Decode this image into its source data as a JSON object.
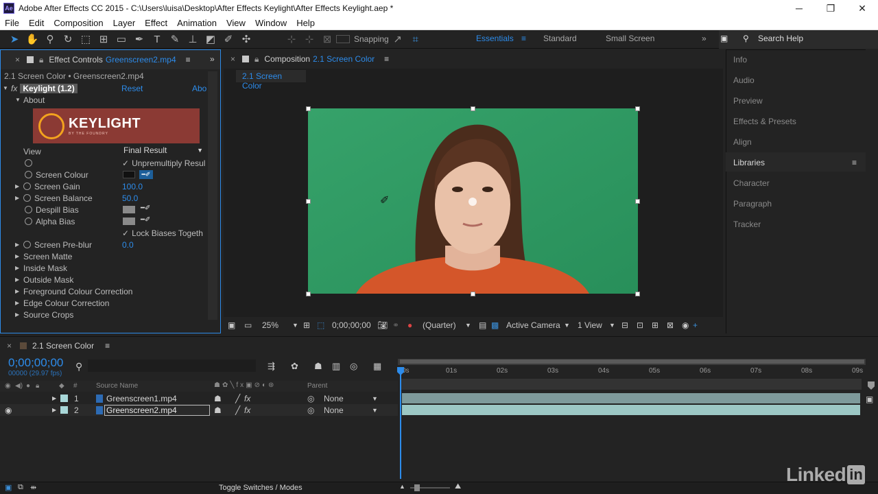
{
  "window": {
    "title": "Adobe After Effects CC 2015 - C:\\Users\\luisa\\Desktop\\After Effects Keylight\\After Effects Keylight.aep *",
    "logo_text": "Ae",
    "minimize": "─",
    "restore": "❐",
    "close": "✕"
  },
  "menu": [
    "File",
    "Edit",
    "Composition",
    "Layer",
    "Effect",
    "Animation",
    "View",
    "Window",
    "Help"
  ],
  "toolbar": {
    "snapping": "Snapping",
    "workspaces": [
      "Essentials",
      "Standard",
      "Small Screen"
    ],
    "search": "Search Help"
  },
  "effect_controls": {
    "tab_label": "Effect Controls",
    "tab_file": "Greenscreen2.mp4",
    "subtitle": "2.1 Screen Color • Greenscreen2.mp4",
    "effect_name": "Keylight (1.2)",
    "reset": "Reset",
    "about_link": "Abo",
    "about": "About",
    "logo_text": "KEYLIGHT",
    "logo_sub": "BY THE FOUNDRY",
    "view_label": "View",
    "view_value": "Final Result",
    "unpremultiply": "Unpremultiply Resul",
    "screen_colour": "Screen Colour",
    "screen_gain": "Screen Gain",
    "screen_gain_val": "100.0",
    "screen_balance": "Screen Balance",
    "screen_balance_val": "50.0",
    "despill_bias": "Despill Bias",
    "alpha_bias": "Alpha Bias",
    "lock_biases": "Lock Biases Togeth",
    "screen_preblur": "Screen Pre-blur",
    "screen_preblur_val": "0.0",
    "sections": [
      "Screen Matte",
      "Inside Mask",
      "Outside Mask",
      "Foreground Colour Correction",
      "Edge Colour Correction",
      "Source Crops"
    ]
  },
  "composition": {
    "tab_label": "Composition",
    "tab_name": "2.1 Screen Color",
    "sub_tab": "2.1 Screen Color",
    "zoom": "25%",
    "timecode": "0;00;00;00",
    "resolution": "(Quarter)",
    "camera": "Active Camera",
    "views": "1 View"
  },
  "right_panel": [
    "Info",
    "Audio",
    "Preview",
    "Effects & Presets",
    "Align",
    "Libraries",
    "Character",
    "Paragraph",
    "Tracker"
  ],
  "timeline": {
    "tab": "2.1 Screen Color",
    "timecode": "0;00;00;00",
    "fps": "00000 (29.97 fps)",
    "col_source": "Source Name",
    "col_parent": "Parent",
    "col_num": "#",
    "layers": [
      {
        "num": "1",
        "name": "Greenscreen1.mp4",
        "parent": "None"
      },
      {
        "num": "2",
        "name": "Greenscreen2.mp4",
        "parent": "None"
      }
    ],
    "ticks": [
      "0s",
      "01s",
      "02s",
      "03s",
      "04s",
      "05s",
      "06s",
      "07s",
      "08s",
      "09s"
    ],
    "toggle": "Toggle Switches / Modes"
  },
  "watermark": "Linked",
  "watermark_in": "in",
  "colors": {
    "accent": "#2d8ceb",
    "green_screen": "#2f9a63",
    "panel": "#232323"
  }
}
